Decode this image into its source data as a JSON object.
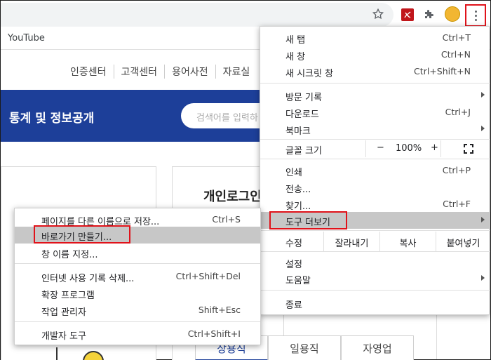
{
  "browser": {
    "bookmark": "YouTube",
    "icons": [
      "star-icon",
      "pdf-extension-icon",
      "puzzle-icon",
      "profile-avatar",
      "kebab-menu-icon"
    ]
  },
  "page": {
    "nav": [
      "인증센터",
      "고객센터",
      "용어사전",
      "자료실"
    ],
    "banner_title": "통계 및 정보공개",
    "search_placeholder": "검색어를 입력하",
    "login_title": "개인로그인",
    "emp_tabs": [
      "상용직",
      "일용직",
      "자영업"
    ]
  },
  "main_menu": {
    "new_tab": "새 탭",
    "new_tab_sc": "Ctrl+T",
    "new_window": "새 창",
    "new_window_sc": "Ctrl+N",
    "incognito": "새 시크릿 창",
    "incognito_sc": "Ctrl+Shift+N",
    "history": "방문 기록",
    "downloads": "다운로드",
    "downloads_sc": "Ctrl+J",
    "bookmarks": "북마크",
    "zoom_label": "글꼴 크기",
    "zoom_minus": "−",
    "zoom_value": "100%",
    "zoom_plus": "+",
    "print": "인쇄",
    "print_sc": "Ctrl+P",
    "cast": "전송...",
    "find": "찾기...",
    "find_sc": "Ctrl+F",
    "more_tools": "도구 더보기",
    "edit_label": "수정",
    "cut": "잘라내기",
    "copy": "복사",
    "paste": "붙여넣기",
    "settings": "설정",
    "help": "도움말",
    "exit": "종료"
  },
  "sub_menu": {
    "save_as": "페이지를 다른 이름으로 저장...",
    "save_as_sc": "Ctrl+S",
    "create_shortcut": "바로가기 만들기...",
    "name_window": "창 이름 지정...",
    "clear_data": "인터넷 사용 기록 삭제...",
    "clear_data_sc": "Ctrl+Shift+Del",
    "extensions": "확장 프로그램",
    "task_manager": "작업 관리자",
    "task_manager_sc": "Shift+Esc",
    "dev_tools": "개발자 도구",
    "dev_tools_sc": "Ctrl+Shift+I"
  }
}
